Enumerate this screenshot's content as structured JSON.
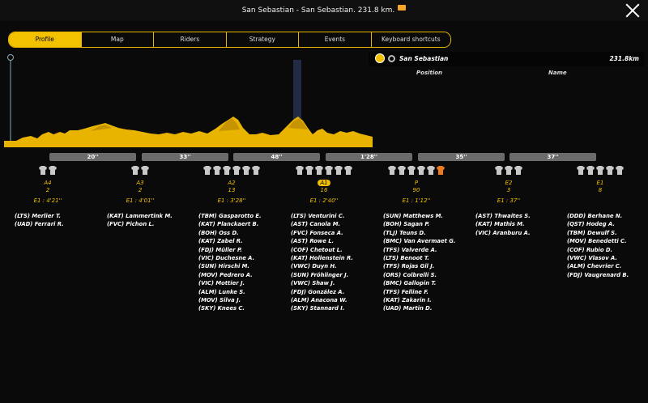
{
  "window": {
    "title": "San Sebastian - San Sebastian. 231.8 km."
  },
  "tabs": [
    "Profile",
    "Map",
    "Riders",
    "Strategy",
    "Events",
    "Keyboard shortcuts"
  ],
  "active_tab": "Profile",
  "right_panel": {
    "location": "San Sebastian",
    "distance": "231.8km",
    "col_position": "Position",
    "col_name": "Name"
  },
  "gap_bars": [
    "20''",
    "33''",
    "48''",
    "1'28''",
    "35''",
    "37''"
  ],
  "colors": {
    "accent": "#f2c200",
    "profile": "#e8b400",
    "highlight_jersey": "#f07820"
  },
  "groups": [
    {
      "label": "A4",
      "count": "2",
      "time": "E1 : 4'21''",
      "jerseys": [
        "white",
        "white"
      ],
      "riders": [
        "(LTS) Merlier T.",
        "(UAD) Ferrari R."
      ]
    },
    {
      "label": "A3",
      "count": "2",
      "time": "E1 : 4'01''",
      "jerseys": [
        "white",
        "white"
      ],
      "riders": [
        "(KAT) Lammertink M.",
        "(FVC) Pichon L."
      ]
    },
    {
      "label": "A2",
      "count": "13",
      "time": "E1 : 3'28''",
      "jerseys": [
        "white",
        "white",
        "white",
        "white",
        "white",
        "white"
      ],
      "riders": [
        "(TBM) Gasparotto E.",
        "(KAT) Planckaert B.",
        "(BOH) Oss D.",
        "(KAT) Zabel R.",
        "(FDJ) Müller P.",
        "(VIC) Duchesne A.",
        "(SUN) Hirschi M.",
        "(MOV) Pedrero A.",
        "(VIC) Mottier J.",
        "(ALM) Lunke S.",
        "(MOV) Silva J.",
        "(SKY) Knees C."
      ]
    },
    {
      "label": "A1",
      "count": "16",
      "time": "E1 : 2'40''",
      "jerseys": [
        "white",
        "white",
        "white",
        "white",
        "white",
        "white"
      ],
      "riders": [
        "(LTS) Venturini C.",
        "(AST) Canola M.",
        "(FVC) Fonseca A.",
        "(AST) Rowe L.",
        "(COF) Chetout L.",
        "(KAT) Hollenstein R.",
        "(VWC) Duyn H.",
        "(SUN) Fröhlinger J.",
        "(VWC) Shaw J.",
        "(FDJ) González A.",
        "(ALM) Anacona W.",
        "(SKY) Stannard I."
      ]
    },
    {
      "label": "P",
      "count": "90",
      "time": "E1 : 1'12''",
      "jerseys": [
        "white",
        "white",
        "white",
        "white",
        "white",
        "orange"
      ],
      "riders": [
        "(SUN) Matthews M.",
        "(BOH) Sagan P.",
        "(TLJ) Teuns D.",
        "(BMC) Van Avermaet G.",
        "(TFS) Valverde A.",
        "(LTS) Benoot T.",
        "(TFS) Rojas Gil J.",
        "(ORS) Colbrelli S.",
        "(BMC) Gallopin T.",
        "(TFS) Felline F.",
        "(KAT) Zakarin I.",
        "(UAD) Martin D."
      ]
    },
    {
      "label": "E2",
      "count": "3",
      "time": "E1 : 37''",
      "jerseys": [
        "white",
        "white",
        "white"
      ],
      "riders": [
        "(AST) Thwaites S.",
        "(KAT) Mathis M.",
        "(VIC) Aranburu A."
      ]
    },
    {
      "label": "E1",
      "count": "8",
      "time": "",
      "jerseys": [
        "white",
        "white",
        "white",
        "white",
        "white"
      ],
      "riders": [
        "(DDD) Berhane N.",
        "(QST) Hodeg A.",
        "(TBM) Dewulf S.",
        "(MOV) Benedetti C.",
        "(COF) Rubio D.",
        "(VWC) Vlasov A.",
        "(ALM) Chevrier C.",
        "(FDJ) Vaugrenard B."
      ]
    }
  ]
}
